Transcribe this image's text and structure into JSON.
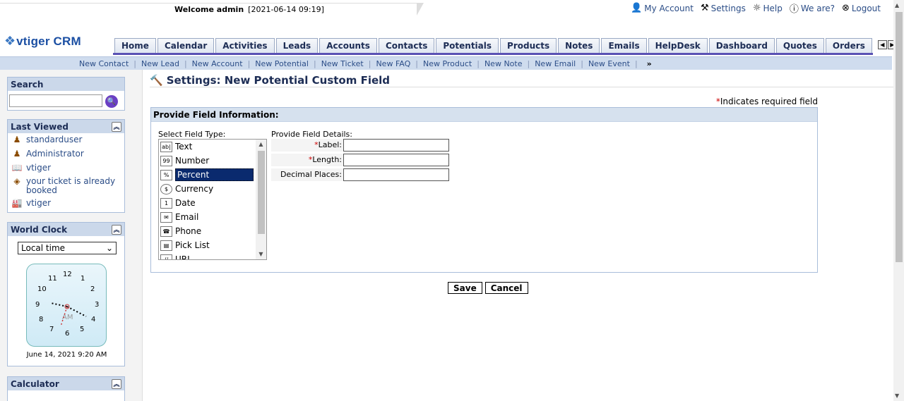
{
  "header": {
    "welcome_label": "Welcome admin",
    "datetime": "[2021-06-14 09:19]",
    "links": [
      {
        "label": "My Account",
        "icon": "user-icon"
      },
      {
        "label": "Settings",
        "icon": "wrench-icon"
      },
      {
        "label": "Help",
        "icon": "bulb-icon"
      },
      {
        "label": "We are?",
        "icon": "info-icon"
      },
      {
        "label": "Logout",
        "icon": "close-circle-icon"
      }
    ]
  },
  "logo": {
    "text": "tiger CRM",
    "first_letter": "v"
  },
  "tabs": [
    "Home",
    "Calendar",
    "Activities",
    "Leads",
    "Accounts",
    "Contacts",
    "Potentials",
    "Products",
    "Notes",
    "Emails",
    "HelpDesk",
    "Dashboard",
    "Quotes",
    "Orders"
  ],
  "subnav": [
    "New Contact",
    "New Lead",
    "New Account",
    "New Potential",
    "New Ticket",
    "New FAQ",
    "New Product",
    "New Note",
    "New Email",
    "New Event"
  ],
  "sidebar": {
    "search_title": "Search",
    "last_viewed_title": "Last Viewed",
    "last_viewed": [
      {
        "label": "standarduser",
        "icon": "user-icon"
      },
      {
        "label": "Administrator",
        "icon": "user-icon"
      },
      {
        "label": "vtiger",
        "icon": "book-icon"
      },
      {
        "label": "your ticket is already booked",
        "icon": "ticket-icon"
      },
      {
        "label": "vtiger",
        "icon": "building-icon"
      }
    ],
    "world_clock_title": "World Clock",
    "clock_select": "Local time",
    "clock_ampm": "AM",
    "clock_date": "June 14, 2021 9:20 AM",
    "calculator_title": "Calculator"
  },
  "main": {
    "title": "Settings: New Potential Custom Field",
    "required_note": "Indicates required field",
    "form_header": "Provide Field Information:",
    "select_type_label": "Select Field Type:",
    "details_label": "Provide Field Details:",
    "field_types": [
      {
        "label": "Text",
        "icon": "ab|"
      },
      {
        "label": "Number",
        "icon": "99"
      },
      {
        "label": "Percent",
        "icon": "%"
      },
      {
        "label": "Currency",
        "icon": "$"
      },
      {
        "label": "Date",
        "icon": "1"
      },
      {
        "label": "Email",
        "icon": "@"
      },
      {
        "label": "Phone",
        "icon": "☎"
      },
      {
        "label": "Pick List",
        "icon": "▤"
      },
      {
        "label": "URL",
        "icon": "//"
      }
    ],
    "selected_type": "Percent",
    "details": [
      {
        "label": "Label:",
        "required": true,
        "value": ""
      },
      {
        "label": "Length:",
        "required": true,
        "value": ""
      },
      {
        "label": "Decimal Places:",
        "required": false,
        "value": ""
      }
    ],
    "save_label": "Save",
    "cancel_label": "Cancel"
  }
}
